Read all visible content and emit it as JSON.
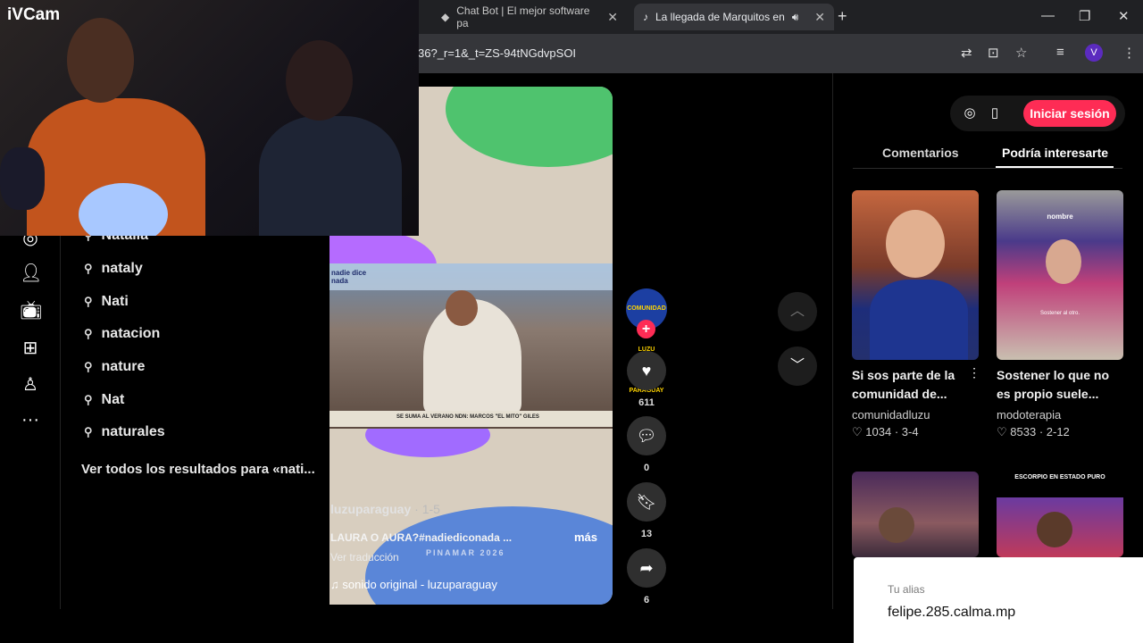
{
  "webcam": {
    "brand": "iVCam"
  },
  "browser": {
    "tabs": [
      {
        "title": "Chat Bot | El mejor software pa",
        "icon": "diamond-icon"
      },
      {
        "title": "La llegada de Marquitos en",
        "icon": "tiktok-icon",
        "active": true
      }
    ],
    "new_tab": "+",
    "url": "36?_r=1&_t=ZS-94tNGdvpSOI",
    "profile_initial": "V"
  },
  "search_suggestions": {
    "items": [
      "Natalia",
      "nataly",
      "Nati",
      "natacion",
      "nature",
      "Nat",
      "naturales"
    ],
    "see_all": "Ver todos los resultados para «nati..."
  },
  "video": {
    "banner_text": "SE SUMA AL VERANO NDN: MARCOS \"EL MITO\" GILES",
    "show_logo": "nadie dice nada",
    "watermark": "PINAMAR 2026",
    "author": "luzuparaguay",
    "date": "· 1-5",
    "caption": "LAURA O AURA?#nadiediconada ...",
    "more": "más",
    "translate": "Ver traducción",
    "sound": "sonido original - luzuparaguay"
  },
  "actions": {
    "avatar_text": "COMUNIDAD LUZU PARAGUAY",
    "likes": "611",
    "comments": "0",
    "saves": "13",
    "shares": "6"
  },
  "right_panel": {
    "login": "Iniciar sesión",
    "tabs": [
      "Comentarios",
      "Podría interesarte"
    ],
    "cards": [
      {
        "title": "Si sos parte de la comunidad de...",
        "user": "comunidadluzu",
        "likes": "1034",
        "date": "· 3-4"
      },
      {
        "title": "Sostener lo que no es propio suele...",
        "user": "modoterapia",
        "likes": "8533",
        "date": "· 2-12",
        "overlay_top": "nombre",
        "overlay_sub": "Sostener al otro."
      },
      {
        "title": "",
        "user": "",
        "likes": "",
        "date": ""
      },
      {
        "title": "",
        "user": "",
        "likes": "",
        "date": "",
        "overlay_top": "ESCORPIO EN ESTADO PURO"
      }
    ]
  },
  "alias": {
    "label": "Tu alias",
    "value": "felipe.285.calma.mp"
  },
  "colors": {
    "accent": "#fe2c55",
    "chrome_bg": "#202124",
    "toolbar_bg": "#35363a"
  }
}
